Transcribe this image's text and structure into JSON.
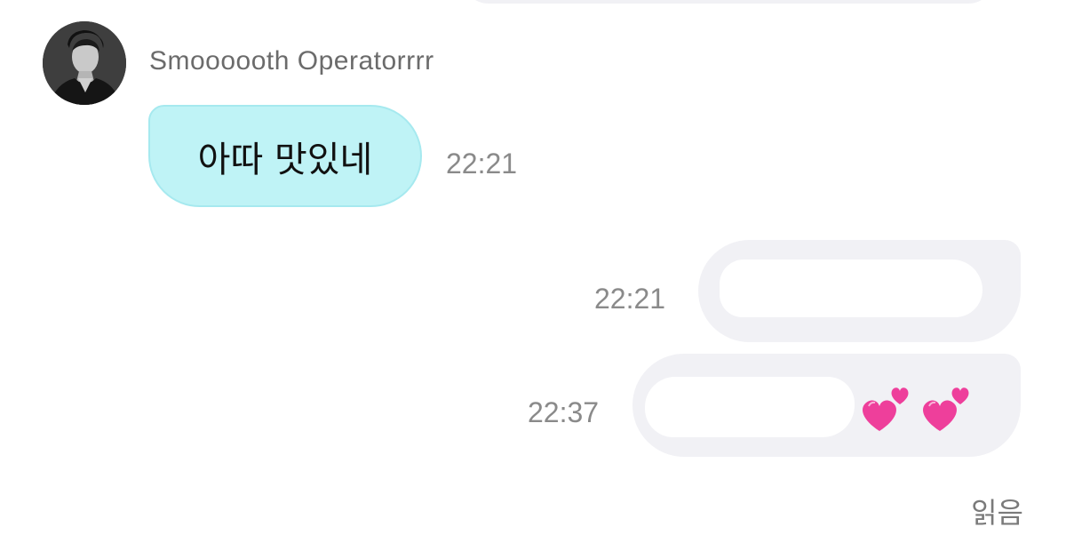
{
  "messages": [
    {
      "sender": "Smoooooth Operatorrrr",
      "text": "아따 맛있네",
      "time": "22:21",
      "direction": "incoming"
    },
    {
      "text": "",
      "time": "22:21",
      "direction": "outgoing"
    },
    {
      "text": "",
      "time": "22:37",
      "direction": "outgoing",
      "emoji": [
        "two-hearts",
        "two-hearts"
      ]
    }
  ],
  "read_status": "읽음",
  "colors": {
    "incoming_bubble": "#bff3f6",
    "outgoing_bubble": "#f1f1f5",
    "timestamp": "#8a8a8a",
    "sender_name": "#6b6b6b",
    "heart": "#ee3f9b"
  }
}
